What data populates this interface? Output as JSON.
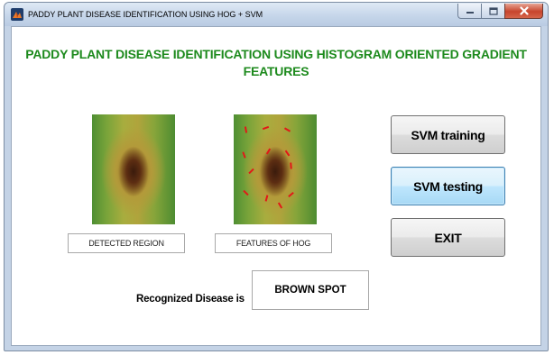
{
  "window": {
    "title": "PADDY PLANT DISEASE IDENTIFICATION USING HOG + SVM",
    "icon": "matlab-figure-icon",
    "controls": [
      "minimize-icon",
      "maximize-icon",
      "close-icon"
    ]
  },
  "main": {
    "heading_line1": "PADDY PLANT DISEASE IDENTIFICATION USING HISTOGRAM ORIENTED GRADIENT",
    "heading_line2": "FEATURES",
    "heading_color": "#1d8a1d",
    "images": [
      {
        "name": "detected-region-image",
        "caption": "DETECTED REGION"
      },
      {
        "name": "hog-features-image",
        "caption": "FEATURES OF HOG",
        "overlay_color": "#e21818"
      }
    ],
    "buttons": {
      "svm_training": "SVM training",
      "svm_testing": "SVM testing",
      "exit": "EXIT"
    },
    "result": {
      "label": "Recognized Disease is",
      "value": "BROWN SPOT"
    }
  }
}
